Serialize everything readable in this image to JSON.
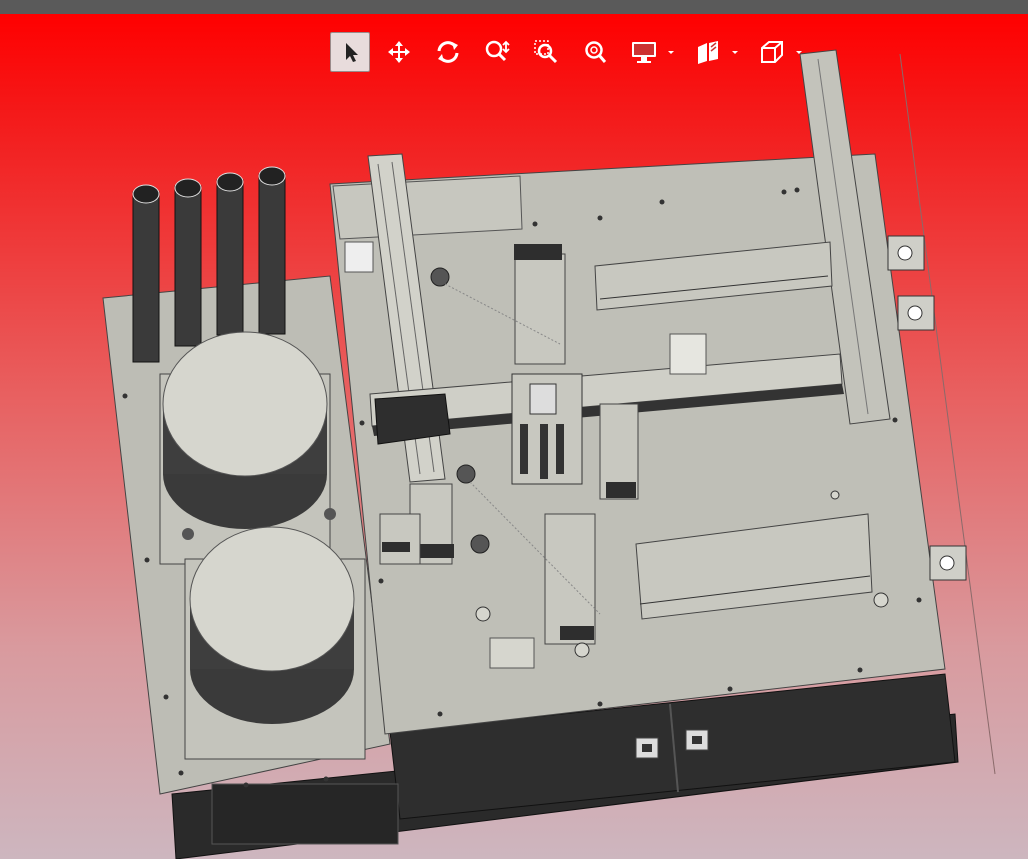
{
  "viewer": {
    "toolbar": {
      "tools": [
        {
          "name": "select",
          "icon": "cursor-icon",
          "active": true
        },
        {
          "name": "pan",
          "icon": "move-icon",
          "active": false
        },
        {
          "name": "rotate",
          "icon": "rotate-icon",
          "active": false
        },
        {
          "name": "zoom",
          "icon": "zoom-icon",
          "active": false
        },
        {
          "name": "zoom-window",
          "icon": "zoom-window-icon",
          "active": false
        },
        {
          "name": "zoom-fit",
          "icon": "zoom-fit-icon",
          "active": false
        },
        {
          "name": "display-style",
          "icon": "monitor-icon",
          "has_dropdown": true
        },
        {
          "name": "section",
          "icon": "section-icon",
          "has_dropdown": true
        },
        {
          "name": "views",
          "icon": "cube-icon",
          "has_dropdown": true
        }
      ],
      "active_color": "#e8dcdc",
      "icon_color": "#ffffff"
    },
    "background": {
      "top_color": "#ff0000",
      "bottom_color": "#cdb6bf"
    },
    "model": {
      "description": "3D CAD assembly",
      "base_color": "#bebeb6",
      "dark_color": "#2c2c2c"
    }
  }
}
